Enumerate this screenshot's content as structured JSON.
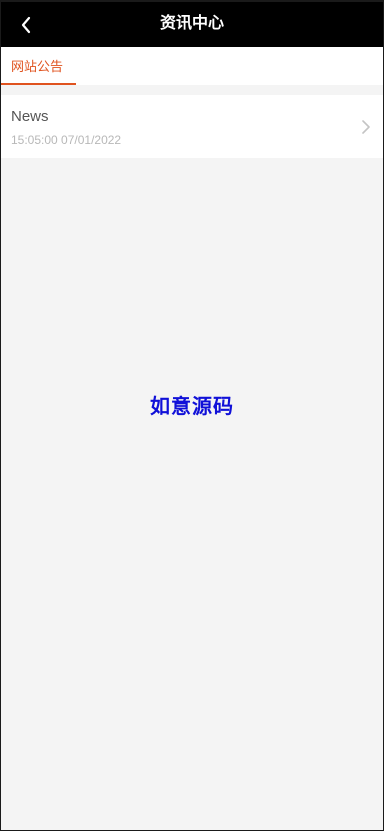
{
  "header": {
    "title": "资讯中心",
    "back_icon": "chevron-left-icon"
  },
  "tabs": [
    {
      "label": "网站公告",
      "active": true
    }
  ],
  "news_list": [
    {
      "title": "News",
      "time": "15:05:00 07/01/2022",
      "icon": "chevron-right-icon"
    }
  ],
  "watermark": "如意源码",
  "colors": {
    "header_bg": "#000000",
    "accent": "#e0531f",
    "page_bg": "#f4f4f4",
    "watermark": "#1010d8"
  }
}
